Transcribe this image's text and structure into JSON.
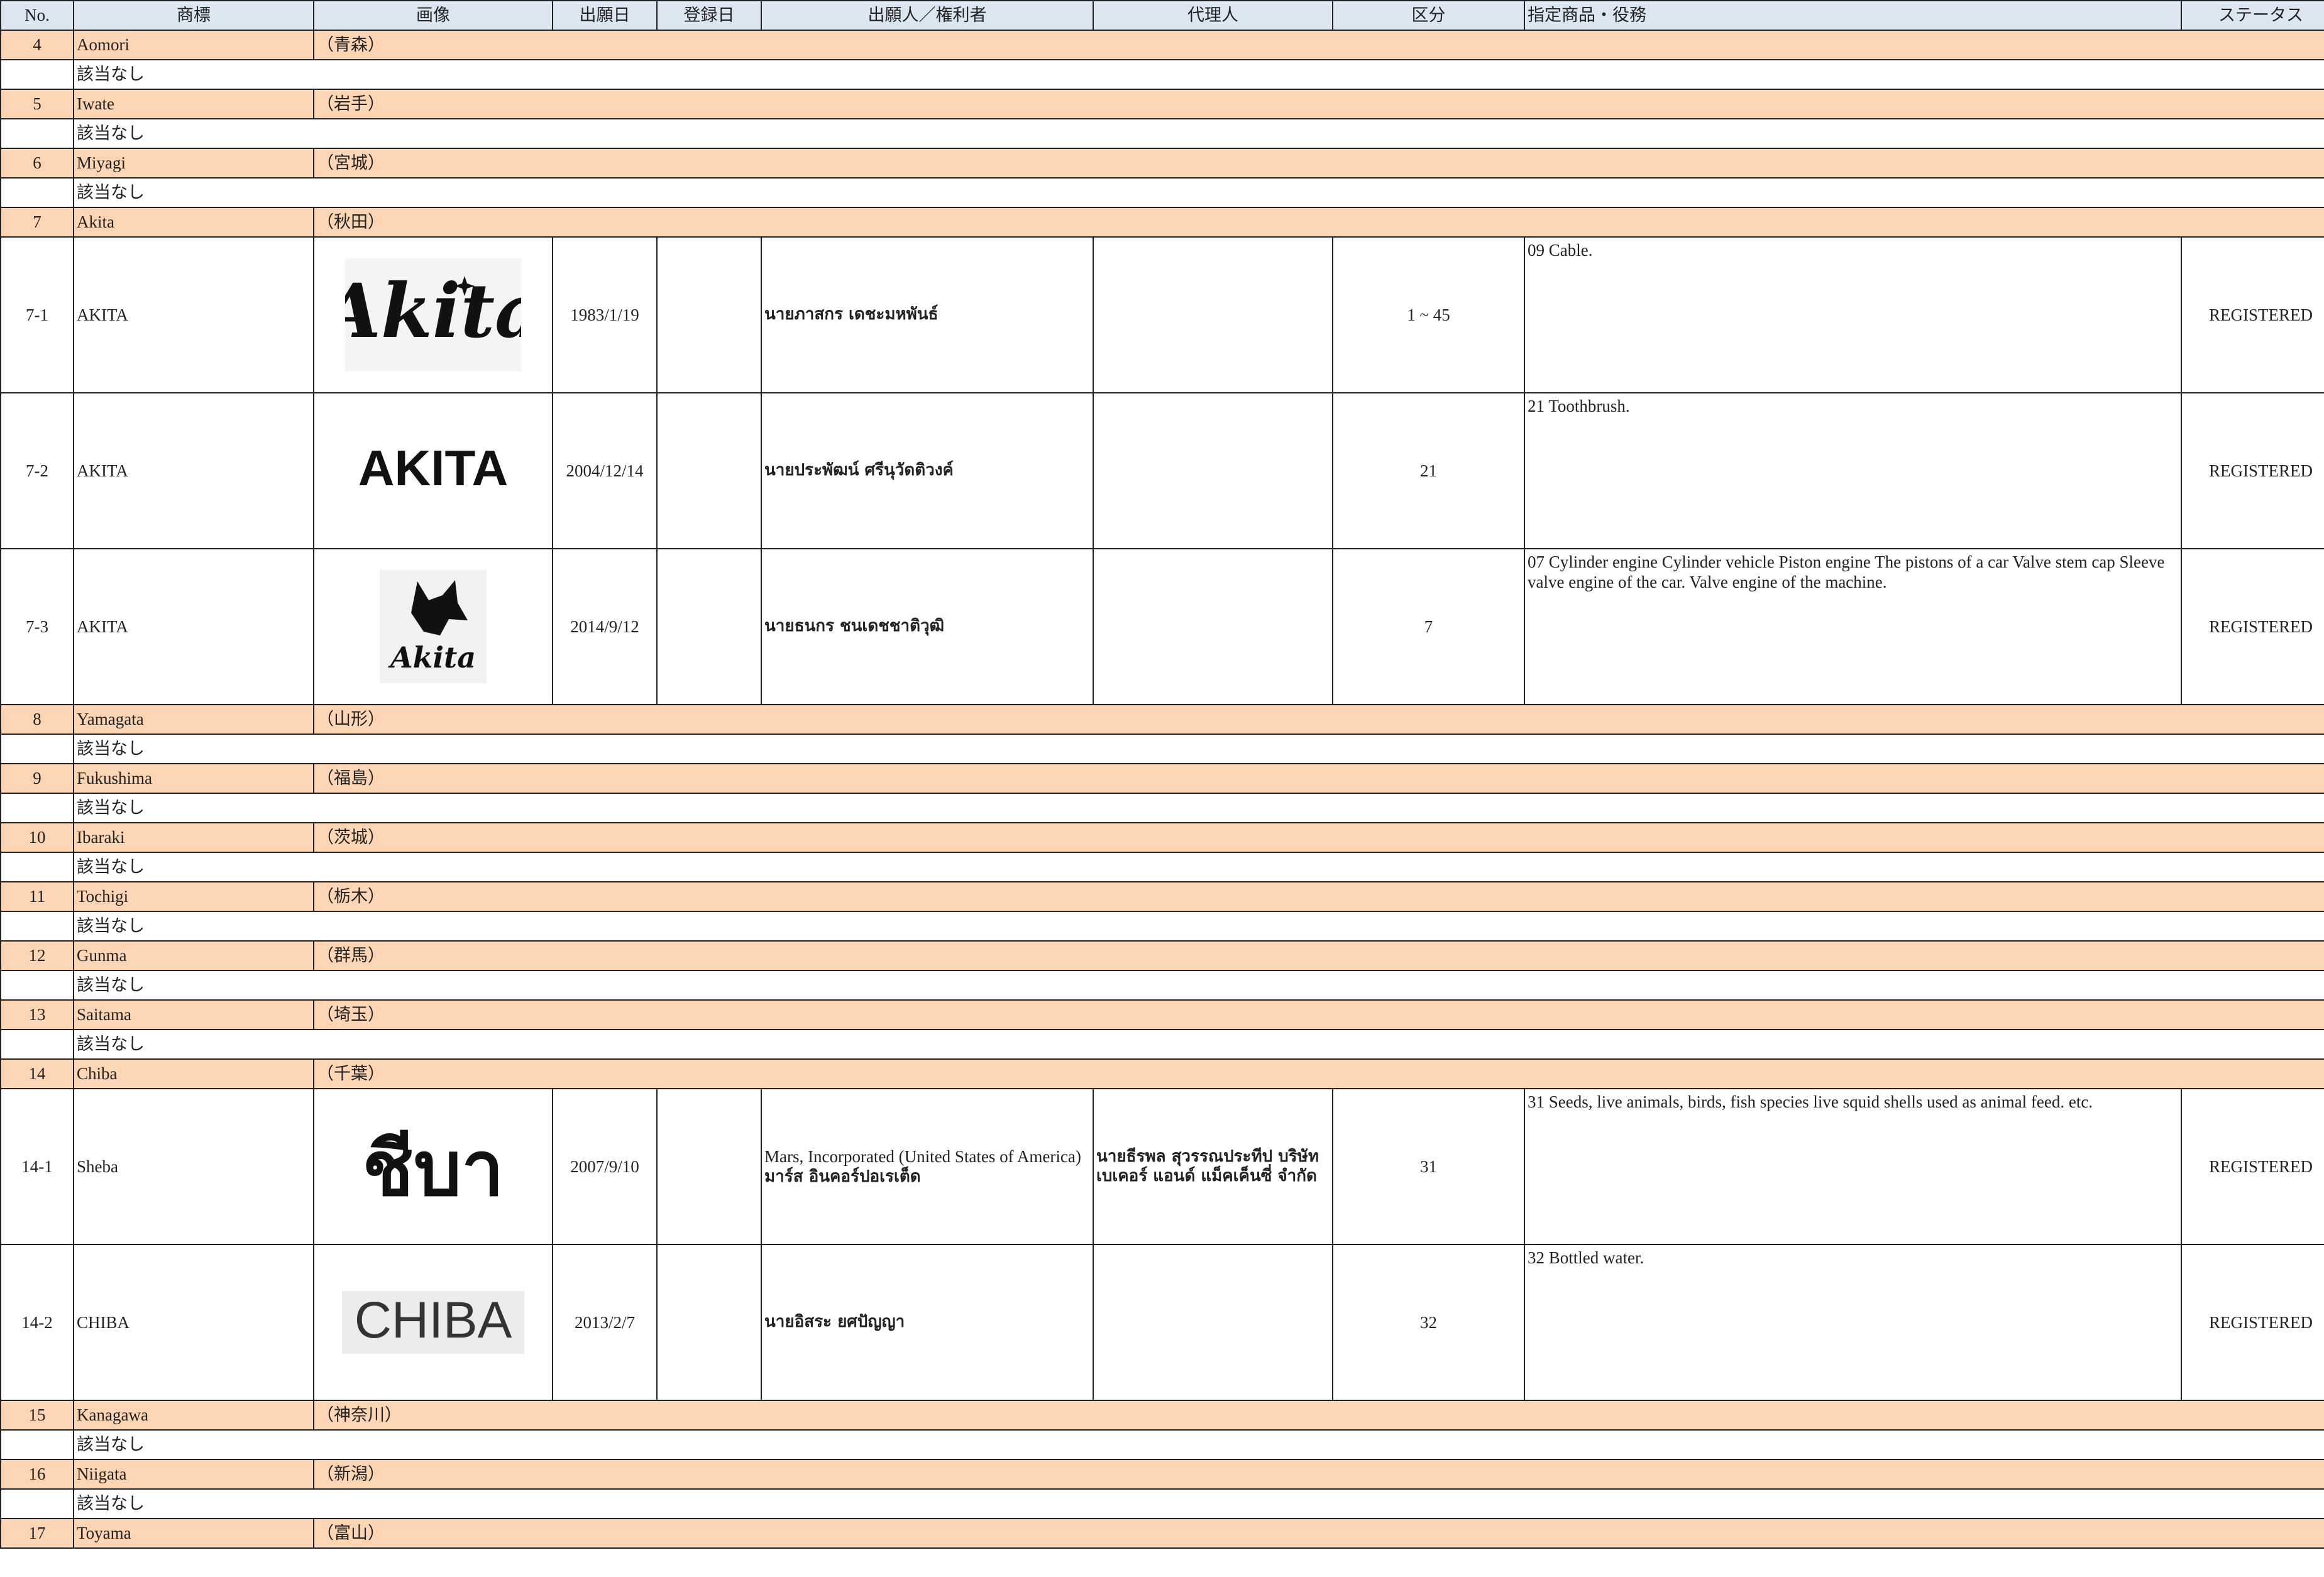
{
  "columns": [
    "No.",
    "商標",
    "画像",
    "出願日",
    "登録日",
    "出願人／権利者",
    "代理人",
    "区分",
    "指定商品・役務",
    "ステータス"
  ],
  "rows": [
    {
      "kind": "prefecture",
      "no": "4",
      "name": "Aomori",
      "jp": "（青森）"
    },
    {
      "kind": "none",
      "text": "該当なし"
    },
    {
      "kind": "prefecture",
      "no": "5",
      "name": "Iwate",
      "jp": "（岩手）"
    },
    {
      "kind": "none",
      "text": "該当なし"
    },
    {
      "kind": "prefecture",
      "no": "6",
      "name": "Miyagi",
      "jp": "（宮城）"
    },
    {
      "kind": "none",
      "text": "該当なし"
    },
    {
      "kind": "prefecture",
      "no": "7",
      "name": "Akita",
      "jp": "（秋田）"
    },
    {
      "kind": "entry",
      "no": "7-1",
      "mark": "AKITA",
      "image": {
        "type": "gothic-logo",
        "text": "Akita"
      },
      "filing_date": "1983/1/19",
      "reg_date": "",
      "applicant": "นายภาสกร เดชะมหพันธ์",
      "applicant_thai": true,
      "agent": "",
      "class": "1 ~ 45",
      "goods": "09 Cable.",
      "status": "REGISTERED"
    },
    {
      "kind": "entry",
      "no": "7-2",
      "mark": "AKITA",
      "image": {
        "type": "bold-text",
        "text": "AKITA"
      },
      "filing_date": "2004/12/14",
      "reg_date": "",
      "applicant": "นายประพัฒน์ ศรีนุวัดติวงค์",
      "applicant_thai": true,
      "agent": "",
      "class": "21",
      "goods": "21 Toothbrush.",
      "status": "REGISTERED"
    },
    {
      "kind": "entry",
      "no": "7-3",
      "mark": "AKITA",
      "image": {
        "type": "dog-logo",
        "text": "Akita"
      },
      "filing_date": "2014/9/12",
      "reg_date": "",
      "applicant": "นายธนกร ชนเดชชาติวุฒิ",
      "applicant_thai": true,
      "agent": "",
      "class": "7",
      "goods": "07 Cylinder engine Cylinder vehicle Piston engine The pistons of a car Valve stem cap Sleeve valve engine of the car. Valve engine of the machine.",
      "status": "REGISTERED"
    },
    {
      "kind": "prefecture",
      "no": "8",
      "name": "Yamagata",
      "jp": "（山形）"
    },
    {
      "kind": "none",
      "text": "該当なし"
    },
    {
      "kind": "prefecture",
      "no": "9",
      "name": "Fukushima",
      "jp": "（福島）"
    },
    {
      "kind": "none",
      "text": "該当なし"
    },
    {
      "kind": "prefecture",
      "no": "10",
      "name": "Ibaraki",
      "jp": "（茨城）"
    },
    {
      "kind": "none",
      "text": "該当なし"
    },
    {
      "kind": "prefecture",
      "no": "11",
      "name": "Tochigi",
      "jp": "（栃木）"
    },
    {
      "kind": "none",
      "text": "該当なし"
    },
    {
      "kind": "prefecture",
      "no": "12",
      "name": "Gunma",
      "jp": "（群馬）"
    },
    {
      "kind": "none",
      "text": "該当なし"
    },
    {
      "kind": "prefecture",
      "no": "13",
      "name": "Saitama",
      "jp": "（埼玉）"
    },
    {
      "kind": "none",
      "text": "該当なし"
    },
    {
      "kind": "prefecture",
      "no": "14",
      "name": "Chiba",
      "jp": "（千葉）"
    },
    {
      "kind": "entry",
      "no": "14-1",
      "mark": "Sheba",
      "image": {
        "type": "thai-text",
        "text": "ชีบา"
      },
      "filing_date": "2007/9/10",
      "reg_date": "",
      "applicant": "Mars, Incorporated (United States of America)",
      "applicant_thai_line": "มาร์ส อินคอร์ปอเรเต็ด",
      "agent": "นายธีรพล สุวรรณประทีป บริษัท เบเคอร์ แอนด์ แม็คเค็นซี่ จำกัด",
      "class": "31",
      "goods": "31 Seeds, live animals, birds, fish species live squid shells used as animal feed. etc.",
      "status": "REGISTERED"
    },
    {
      "kind": "entry",
      "no": "14-2",
      "mark": "CHIBA",
      "image": {
        "type": "grey-text",
        "text": "CHIBA"
      },
      "filing_date": "2013/2/7",
      "reg_date": "",
      "applicant": "นายอิสระ ยศปัญญา",
      "applicant_thai": true,
      "agent": "",
      "class": "32",
      "goods": "32 Bottled water.",
      "status": "REGISTERED"
    },
    {
      "kind": "prefecture",
      "no": "15",
      "name": "Kanagawa",
      "jp": "（神奈川）"
    },
    {
      "kind": "none",
      "text": "該当なし"
    },
    {
      "kind": "prefecture",
      "no": "16",
      "name": "Niigata",
      "jp": "（新潟）"
    },
    {
      "kind": "none",
      "text": "該当なし"
    },
    {
      "kind": "prefecture",
      "no": "17",
      "name": "Toyama",
      "jp": "（富山）"
    }
  ],
  "colors": {
    "header_bg": "#dce6f1",
    "prefecture_bg": "#fcd5b4",
    "grid": "#222222"
  }
}
